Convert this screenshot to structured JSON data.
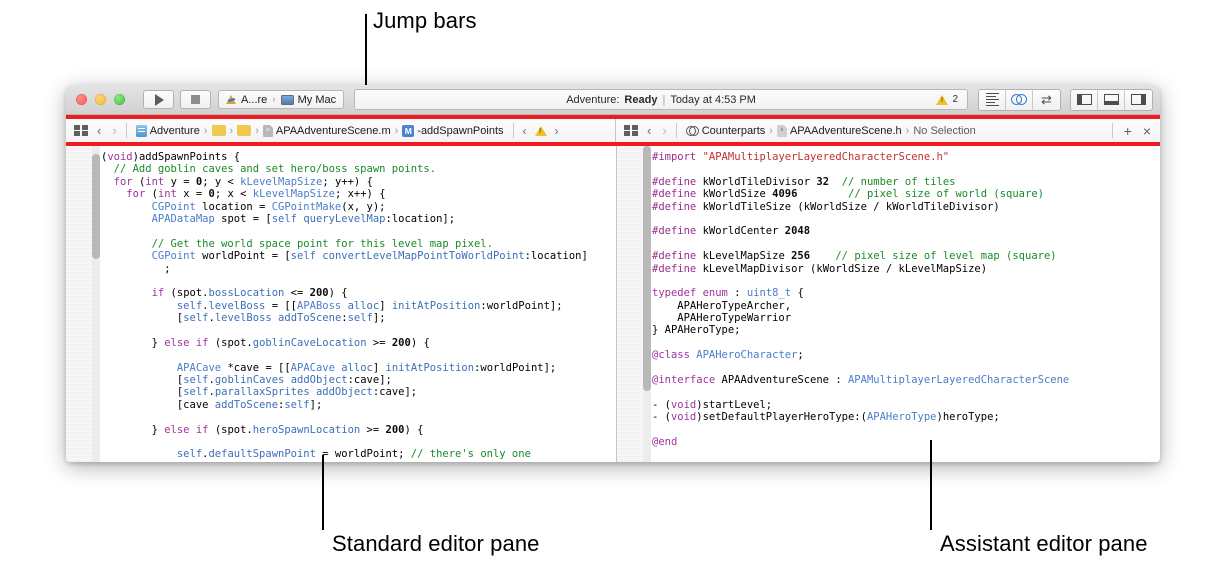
{
  "annotations": [
    {
      "label": "Jump bars",
      "id": "jump-bars"
    },
    {
      "label": "Standard editor pane",
      "id": "standard-editor-pane"
    },
    {
      "label": "Assistant editor pane",
      "id": "assistant-editor-pane"
    }
  ],
  "toolbar": {
    "run_icon": "play-icon",
    "stop_icon": "stop-icon",
    "scheme": "A...re",
    "scheme_icon": "xcode-app-icon",
    "destination": "My Mac",
    "destination_icon": "mac-icon",
    "separator": "›",
    "status_project": "Adventure:",
    "status_state": "Ready",
    "status_divider": "|",
    "status_time": "Today at 4:53 PM",
    "warning_icon": "warning-triangle-icon",
    "warning_count": "2",
    "view_buttons": [
      {
        "name": "standard-editor-button",
        "icon": "lines-icon"
      },
      {
        "name": "assistant-editor-button",
        "icon": "venn-icon"
      },
      {
        "name": "version-editor-button",
        "icon": "two-way-arrow-icon"
      }
    ],
    "panel_buttons": [
      {
        "name": "navigator-toggle-button",
        "icon": "left-panel-icon"
      },
      {
        "name": "debug-area-toggle-button",
        "icon": "bottom-panel-icon"
      },
      {
        "name": "utilities-toggle-button",
        "icon": "right-panel-icon"
      }
    ]
  },
  "jumpbar_left": {
    "related_items_icon": "related-items-icon",
    "back_arrow": "‹",
    "forward_arrow": "›",
    "crumbs": [
      {
        "label": "Adventure",
        "icon": "project-icon"
      },
      {
        "label": "",
        "icon": "folder-icon"
      },
      {
        "label": "",
        "icon": "folder-icon"
      },
      {
        "label": "APAAdventureScene.m",
        "icon": "m-file-icon"
      },
      {
        "label": "-addSpawnPoints",
        "icon": "method-m-icon"
      }
    ],
    "crumb_separator": "›",
    "issue_prev": "‹",
    "issue_icon": "warning-triangle-icon",
    "issue_next": "›"
  },
  "jumpbar_right": {
    "related_items_icon": "related-items-icon",
    "back_arrow": "‹",
    "forward_arrow": "›",
    "crumbs": [
      {
        "label": "Counterparts",
        "icon": "counterparts-icon"
      },
      {
        "label": "APAAdventureScene.h",
        "icon": "h-file-icon"
      },
      {
        "label": "No Selection",
        "icon": ""
      }
    ],
    "crumb_separator": "›",
    "add_label": "+",
    "close_label": "×"
  },
  "editor_left": {
    "file": "APAAdventureScene.m",
    "lines": [
      [
        {
          "t": "(",
          "c": "pl"
        },
        {
          "t": "void",
          "c": "kw"
        },
        {
          "t": ")addSpawnPoints {",
          "c": "pl"
        }
      ],
      [
        {
          "t": "  // Add goblin caves and set hero/boss spawn points.",
          "c": "cm"
        }
      ],
      [
        {
          "t": "  ",
          "c": "pl"
        },
        {
          "t": "for",
          "c": "kw"
        },
        {
          "t": " (",
          "c": "pl"
        },
        {
          "t": "int",
          "c": "kw"
        },
        {
          "t": " y = ",
          "c": "pl"
        },
        {
          "t": "0",
          "c": "num"
        },
        {
          "t": "; y < ",
          "c": "pl"
        },
        {
          "t": "kLevelMapSize",
          "c": "ty"
        },
        {
          "t": "; y++) {",
          "c": "pl"
        }
      ],
      [
        {
          "t": "    ",
          "c": "pl"
        },
        {
          "t": "for",
          "c": "kw"
        },
        {
          "t": " (",
          "c": "pl"
        },
        {
          "t": "int",
          "c": "kw"
        },
        {
          "t": " x = ",
          "c": "pl"
        },
        {
          "t": "0",
          "c": "num"
        },
        {
          "t": "; x < ",
          "c": "pl"
        },
        {
          "t": "kLevelMapSize",
          "c": "ty"
        },
        {
          "t": "; x++) {",
          "c": "pl"
        }
      ],
      [
        {
          "t": "        ",
          "c": "pl"
        },
        {
          "t": "CGPoint",
          "c": "ty"
        },
        {
          "t": " location = ",
          "c": "pl"
        },
        {
          "t": "CGPointMake",
          "c": "ty"
        },
        {
          "t": "(x, y);",
          "c": "pl"
        }
      ],
      [
        {
          "t": "        ",
          "c": "pl"
        },
        {
          "t": "APADataMap",
          "c": "ty"
        },
        {
          "t": " spot = [",
          "c": "pl"
        },
        {
          "t": "self",
          "c": "bl"
        },
        {
          "t": " ",
          "c": "pl"
        },
        {
          "t": "queryLevelMap",
          "c": "fn"
        },
        {
          "t": ":location];",
          "c": "pl"
        }
      ],
      [
        {
          "t": "",
          "c": "pl"
        }
      ],
      [
        {
          "t": "        // Get the world space point for this level map pixel.",
          "c": "cm"
        }
      ],
      [
        {
          "t": "        ",
          "c": "pl"
        },
        {
          "t": "CGPoint",
          "c": "ty"
        },
        {
          "t": " worldPoint = [",
          "c": "pl"
        },
        {
          "t": "self",
          "c": "bl"
        },
        {
          "t": " ",
          "c": "pl"
        },
        {
          "t": "convertLevelMapPointToWorldPoint",
          "c": "fn"
        },
        {
          "t": ":location]",
          "c": "pl"
        }
      ],
      [
        {
          "t": "          ;",
          "c": "pl"
        }
      ],
      [
        {
          "t": "",
          "c": "pl"
        }
      ],
      [
        {
          "t": "        ",
          "c": "pl"
        },
        {
          "t": "if",
          "c": "kw"
        },
        {
          "t": " (spot.",
          "c": "pl"
        },
        {
          "t": "bossLocation",
          "c": "fn"
        },
        {
          "t": " <= ",
          "c": "pl"
        },
        {
          "t": "200",
          "c": "num"
        },
        {
          "t": ") {",
          "c": "pl"
        }
      ],
      [
        {
          "t": "            ",
          "c": "pl"
        },
        {
          "t": "self",
          "c": "bl"
        },
        {
          "t": ".",
          "c": "pl"
        },
        {
          "t": "levelBoss",
          "c": "fn"
        },
        {
          "t": " = [[",
          "c": "pl"
        },
        {
          "t": "APABoss",
          "c": "ty"
        },
        {
          "t": " ",
          "c": "pl"
        },
        {
          "t": "alloc",
          "c": "fn"
        },
        {
          "t": "] ",
          "c": "pl"
        },
        {
          "t": "initAtPosition",
          "c": "fn"
        },
        {
          "t": ":worldPoint];",
          "c": "pl"
        }
      ],
      [
        {
          "t": "            [",
          "c": "pl"
        },
        {
          "t": "self",
          "c": "bl"
        },
        {
          "t": ".",
          "c": "pl"
        },
        {
          "t": "levelBoss",
          "c": "fn"
        },
        {
          "t": " ",
          "c": "pl"
        },
        {
          "t": "addToScene",
          "c": "fn"
        },
        {
          "t": ":",
          "c": "pl"
        },
        {
          "t": "self",
          "c": "bl"
        },
        {
          "t": "];",
          "c": "pl"
        }
      ],
      [
        {
          "t": "",
          "c": "pl"
        }
      ],
      [
        {
          "t": "        } ",
          "c": "pl"
        },
        {
          "t": "else",
          "c": "kw"
        },
        {
          "t": " ",
          "c": "pl"
        },
        {
          "t": "if",
          "c": "kw"
        },
        {
          "t": " (spot.",
          "c": "pl"
        },
        {
          "t": "goblinCaveLocation",
          "c": "fn"
        },
        {
          "t": " >= ",
          "c": "pl"
        },
        {
          "t": "200",
          "c": "num"
        },
        {
          "t": ") {",
          "c": "pl"
        }
      ],
      [
        {
          "t": "",
          "c": "pl"
        }
      ],
      [
        {
          "t": "            ",
          "c": "pl"
        },
        {
          "t": "APACave",
          "c": "ty"
        },
        {
          "t": " *cave = [[",
          "c": "pl"
        },
        {
          "t": "APACave",
          "c": "ty"
        },
        {
          "t": " ",
          "c": "pl"
        },
        {
          "t": "alloc",
          "c": "fn"
        },
        {
          "t": "] ",
          "c": "pl"
        },
        {
          "t": "initAtPosition",
          "c": "fn"
        },
        {
          "t": ":worldPoint];",
          "c": "pl"
        }
      ],
      [
        {
          "t": "            [",
          "c": "pl"
        },
        {
          "t": "self",
          "c": "bl"
        },
        {
          "t": ".",
          "c": "pl"
        },
        {
          "t": "goblinCaves",
          "c": "fn"
        },
        {
          "t": " ",
          "c": "pl"
        },
        {
          "t": "addObject",
          "c": "fn"
        },
        {
          "t": ":cave];",
          "c": "pl"
        }
      ],
      [
        {
          "t": "            [",
          "c": "pl"
        },
        {
          "t": "self",
          "c": "bl"
        },
        {
          "t": ".",
          "c": "pl"
        },
        {
          "t": "parallaxSprites",
          "c": "fn"
        },
        {
          "t": " ",
          "c": "pl"
        },
        {
          "t": "addObject",
          "c": "fn"
        },
        {
          "t": ":cave];",
          "c": "pl"
        }
      ],
      [
        {
          "t": "            [cave ",
          "c": "pl"
        },
        {
          "t": "addToScene",
          "c": "fn"
        },
        {
          "t": ":",
          "c": "pl"
        },
        {
          "t": "self",
          "c": "bl"
        },
        {
          "t": "];",
          "c": "pl"
        }
      ],
      [
        {
          "t": "",
          "c": "pl"
        }
      ],
      [
        {
          "t": "        } ",
          "c": "pl"
        },
        {
          "t": "else",
          "c": "kw"
        },
        {
          "t": " ",
          "c": "pl"
        },
        {
          "t": "if",
          "c": "kw"
        },
        {
          "t": " (spot.",
          "c": "pl"
        },
        {
          "t": "heroSpawnLocation",
          "c": "fn"
        },
        {
          "t": " >= ",
          "c": "pl"
        },
        {
          "t": "200",
          "c": "num"
        },
        {
          "t": ") {",
          "c": "pl"
        }
      ],
      [
        {
          "t": "",
          "c": "pl"
        }
      ],
      [
        {
          "t": "            ",
          "c": "pl"
        },
        {
          "t": "self",
          "c": "bl"
        },
        {
          "t": ".",
          "c": "pl"
        },
        {
          "t": "defaultSpawnPoint",
          "c": "fn"
        },
        {
          "t": " = worldPoint; ",
          "c": "pl"
        },
        {
          "t": "// there's only one",
          "c": "cm"
        }
      ]
    ]
  },
  "editor_right": {
    "file": "APAAdventureScene.h",
    "lines": [
      [
        {
          "t": "#import",
          "c": "pp"
        },
        {
          "t": " ",
          "c": "pl"
        },
        {
          "t": "\"APAMultiplayerLayeredCharacterScene.h\"",
          "c": "str"
        }
      ],
      [
        {
          "t": "",
          "c": "pl"
        }
      ],
      [
        {
          "t": "#define",
          "c": "pp"
        },
        {
          "t": " kWorldTileDivisor ",
          "c": "pl"
        },
        {
          "t": "32",
          "c": "num"
        },
        {
          "t": "  ",
          "c": "pl"
        },
        {
          "t": "// number of tiles",
          "c": "cm"
        }
      ],
      [
        {
          "t": "#define",
          "c": "pp"
        },
        {
          "t": " kWorldSize ",
          "c": "pl"
        },
        {
          "t": "4096",
          "c": "num"
        },
        {
          "t": "        ",
          "c": "pl"
        },
        {
          "t": "// pixel size of world (square)",
          "c": "cm"
        }
      ],
      [
        {
          "t": "#define",
          "c": "pp"
        },
        {
          "t": " kWorldTileSize (kWorldSize / kWorldTileDivisor)",
          "c": "pl"
        }
      ],
      [
        {
          "t": "",
          "c": "pl"
        }
      ],
      [
        {
          "t": "#define",
          "c": "pp"
        },
        {
          "t": " kWorldCenter ",
          "c": "pl"
        },
        {
          "t": "2048",
          "c": "num"
        }
      ],
      [
        {
          "t": "",
          "c": "pl"
        }
      ],
      [
        {
          "t": "#define",
          "c": "pp"
        },
        {
          "t": " kLevelMapSize ",
          "c": "pl"
        },
        {
          "t": "256",
          "c": "num"
        },
        {
          "t": "    ",
          "c": "pl"
        },
        {
          "t": "// pixel size of level map (square)",
          "c": "cm"
        }
      ],
      [
        {
          "t": "#define",
          "c": "pp"
        },
        {
          "t": " kLevelMapDivisor (kWorldSize / kLevelMapSize)",
          "c": "pl"
        }
      ],
      [
        {
          "t": "",
          "c": "pl"
        }
      ],
      [
        {
          "t": "typedef",
          "c": "kw"
        },
        {
          "t": " ",
          "c": "pl"
        },
        {
          "t": "enum",
          "c": "kw"
        },
        {
          "t": " : ",
          "c": "pl"
        },
        {
          "t": "uint8_t",
          "c": "ty"
        },
        {
          "t": " {",
          "c": "pl"
        }
      ],
      [
        {
          "t": "    APAHeroTypeArcher,",
          "c": "pl"
        }
      ],
      [
        {
          "t": "    APAHeroTypeWarrior",
          "c": "pl"
        }
      ],
      [
        {
          "t": "} APAHeroType;",
          "c": "pl"
        }
      ],
      [
        {
          "t": "",
          "c": "pl"
        }
      ],
      [
        {
          "t": "@class",
          "c": "kw"
        },
        {
          "t": " ",
          "c": "pl"
        },
        {
          "t": "APAHeroCharacter",
          "c": "ty"
        },
        {
          "t": ";",
          "c": "pl"
        }
      ],
      [
        {
          "t": "",
          "c": "pl"
        }
      ],
      [
        {
          "t": "@interface",
          "c": "kw"
        },
        {
          "t": " APAAdventureScene : ",
          "c": "pl"
        },
        {
          "t": "APAMultiplayerLayeredCharacterScene",
          "c": "ty"
        }
      ],
      [
        {
          "t": "",
          "c": "pl"
        }
      ],
      [
        {
          "t": "- (",
          "c": "pl"
        },
        {
          "t": "void",
          "c": "kw"
        },
        {
          "t": ")startLevel;",
          "c": "pl"
        }
      ],
      [
        {
          "t": "- (",
          "c": "pl"
        },
        {
          "t": "void",
          "c": "kw"
        },
        {
          "t": ")setDefaultPlayerHeroType:(",
          "c": "pl"
        },
        {
          "t": "APAHeroType",
          "c": "ty"
        },
        {
          "t": ")heroType;",
          "c": "pl"
        }
      ],
      [
        {
          "t": "",
          "c": "pl"
        }
      ],
      [
        {
          "t": "@end",
          "c": "kw"
        }
      ]
    ]
  },
  "colors": {
    "highlight_red": "#ee1c20",
    "accent_blue": "#4a84cf",
    "warning_yellow": "#f3bd2e"
  }
}
